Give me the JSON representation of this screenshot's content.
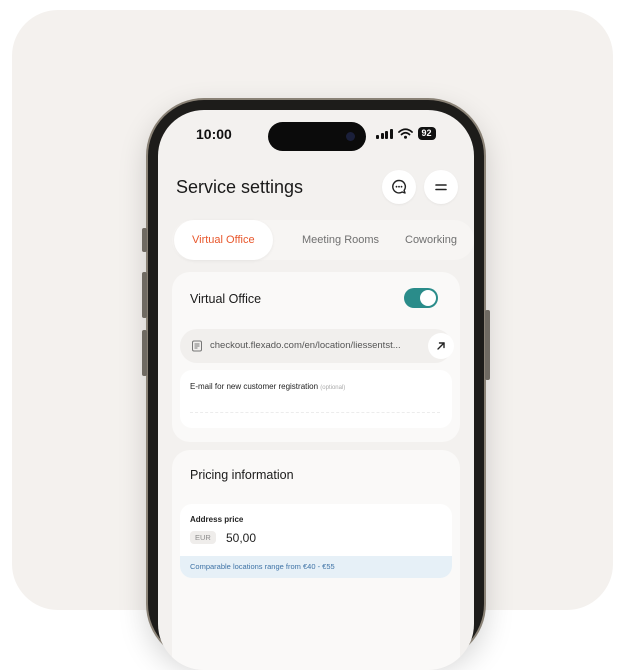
{
  "status_bar": {
    "time": "10:00",
    "battery": "92"
  },
  "header": {
    "title": "Service settings",
    "chat_icon": "chat-icon",
    "menu_icon": "menu-icon"
  },
  "tabs": [
    {
      "label": "Virtual Office",
      "active": true
    },
    {
      "label": "Meeting Rooms",
      "active": false
    },
    {
      "label": "Coworking",
      "active": false
    }
  ],
  "virtual_office": {
    "title": "Virtual Office",
    "enabled": true,
    "url": "checkout.flexado.com/en/location/liessentst...",
    "email_label": "E-mail for new customer registration",
    "email_optional": "(optional)",
    "email_value": ""
  },
  "pricing": {
    "title": "Pricing information",
    "address_price_label": "Address price",
    "currency": "EUR",
    "price_value": "50,00",
    "comparable_note": "Comparable locations range from €40 - €55"
  },
  "colors": {
    "accent": "#e8572c",
    "toggle_on": "#2a8c8a",
    "info_bg": "#e6f0f7",
    "info_text": "#3f73a6"
  }
}
